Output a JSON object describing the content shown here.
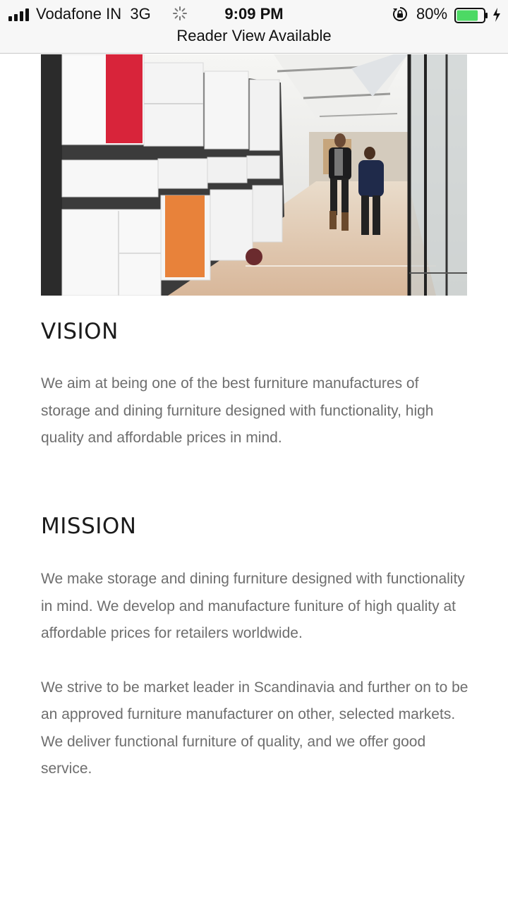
{
  "status_bar": {
    "carrier": "Vodafone IN",
    "network": "3G",
    "time": "9:09 PM",
    "battery_percent": "80%",
    "battery_level": 0.8,
    "battery_color": "#4cd964",
    "icons": [
      "signal-icon",
      "loading-spinner-icon",
      "orientation-lock-icon",
      "battery-icon",
      "charging-icon"
    ]
  },
  "browser": {
    "reader_view_label": "Reader View Available"
  },
  "hero": {
    "image_description_icon": "photo",
    "accent_colors": [
      "#d8243a",
      "#e8823a"
    ]
  },
  "vision": {
    "heading": "VISION",
    "text": "We aim at being one of the best furniture manufactures of storage and dining furniture designed with functionality, high quality and affordable prices in mind."
  },
  "mission": {
    "heading": "MISSION",
    "paragraphs": [
      "We make storage and dining furniture designed with functionality in mind. We develop and manufacture funiture of high quality at affordable prices for retailers worldwide.",
      "We strive to be market leader in Scandinavia and further on to be an approved furniture manufacturer on other, selected markets. We deliver functional furniture of quality, and we offer good service."
    ]
  }
}
